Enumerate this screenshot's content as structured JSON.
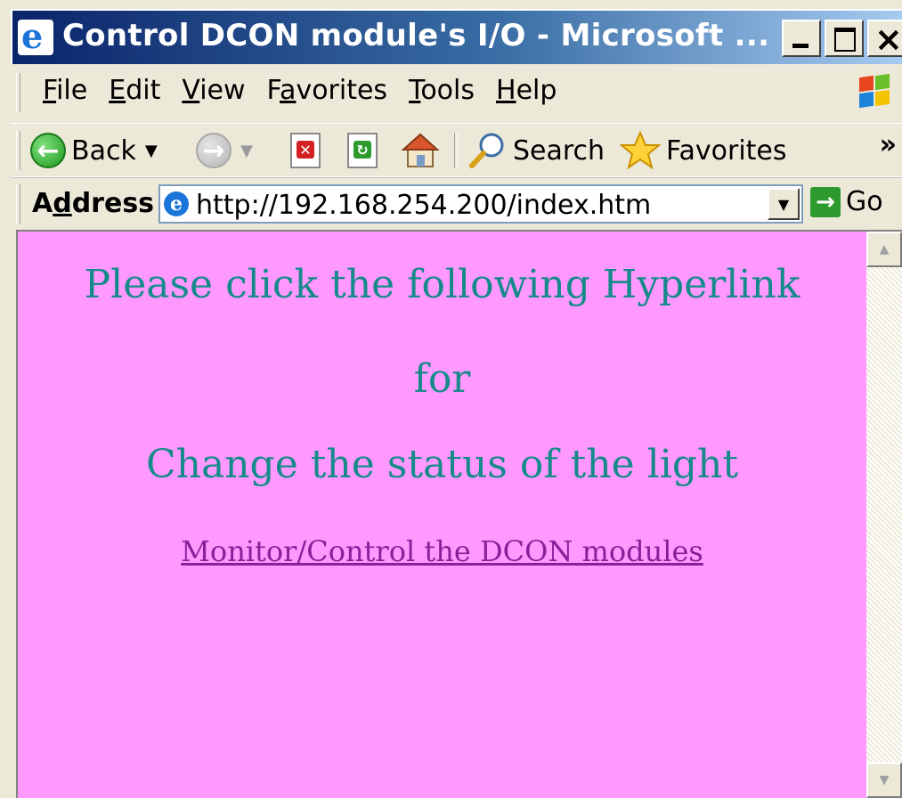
{
  "window": {
    "title": "Control DCON module's I/O - Microsoft ...",
    "close_glyph": "×"
  },
  "menu": {
    "items": [
      {
        "label": "File",
        "key": "F"
      },
      {
        "label": "Edit",
        "key": "E"
      },
      {
        "label": "View",
        "key": "V"
      },
      {
        "label": "Favorites",
        "key": "a"
      },
      {
        "label": "Tools",
        "key": "T"
      },
      {
        "label": "Help",
        "key": "H"
      }
    ]
  },
  "toolbar": {
    "back_label": "Back",
    "search_label": "Search",
    "favorites_label": "Favorites",
    "more": "»"
  },
  "address": {
    "label": "Address",
    "url": "http://192.168.254.200/index.htm",
    "go_label": "Go"
  },
  "content": {
    "line1": "Please click the following Hyperlink",
    "line2": "for",
    "line3": "Change the status of the light",
    "link_text": "Monitor/Control the DCON modules"
  },
  "colors": {
    "page_bg": "#ff99ff",
    "text_teal": "#168a8a",
    "link_purple": "#8a1f9a",
    "titlebar": "#0a246a"
  }
}
